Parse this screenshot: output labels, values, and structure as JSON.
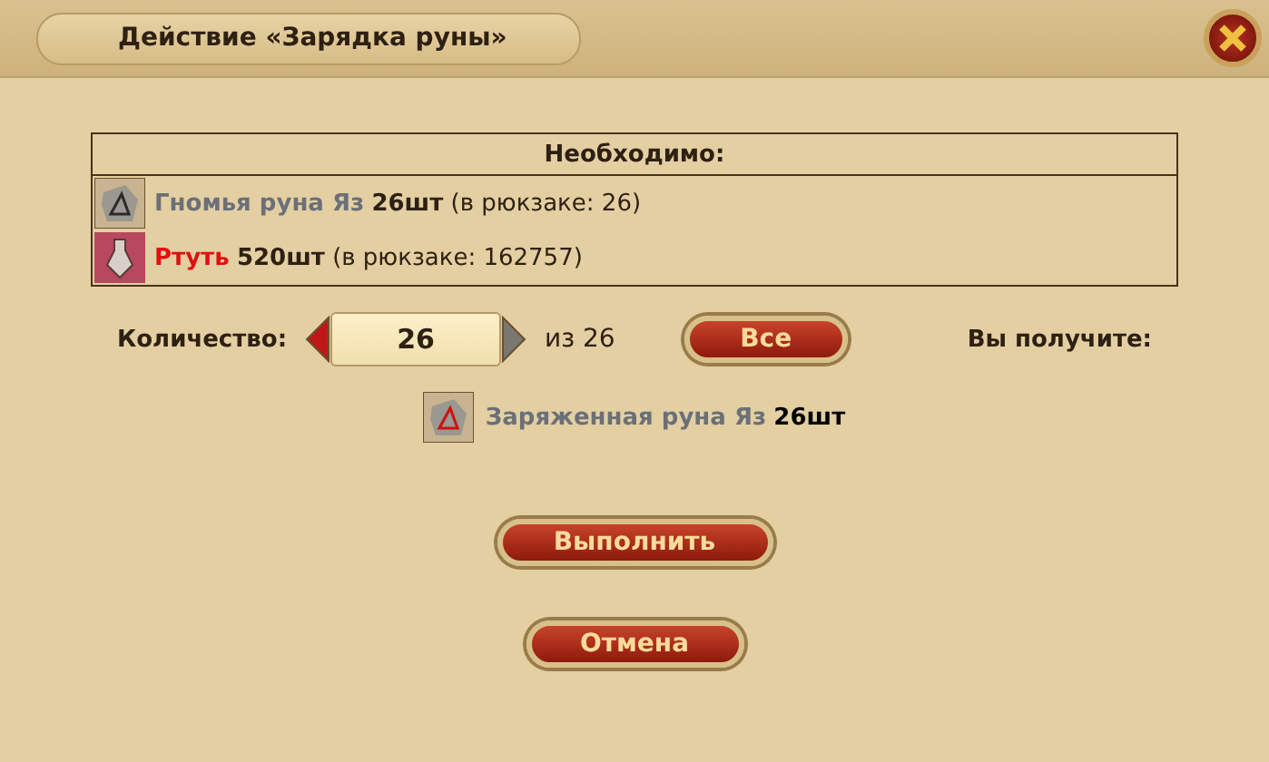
{
  "window": {
    "title": "Действие «Зарядка руны»"
  },
  "requirements": {
    "heading": "Необходимо:",
    "items": [
      {
        "name": "Гномья руна Яз",
        "color": "#6b7078",
        "amount": "26шт",
        "stock": "(в рюкзаке: 26)",
        "kind": "rune"
      },
      {
        "name": "Ртуть",
        "color": "#e01010",
        "amount": "520шт",
        "stock": "(в рюкзаке: 162757)",
        "kind": "mercury"
      }
    ]
  },
  "quantity": {
    "label": "Количество:",
    "value": "26",
    "of": "из 26",
    "all_button": "Все",
    "result_label": "Вы получите:"
  },
  "result": {
    "name": "Заряженная руна Яз",
    "amount": "26шт",
    "kind": "charged-rune"
  },
  "buttons": [
    "Выполнить",
    "Отмена"
  ]
}
